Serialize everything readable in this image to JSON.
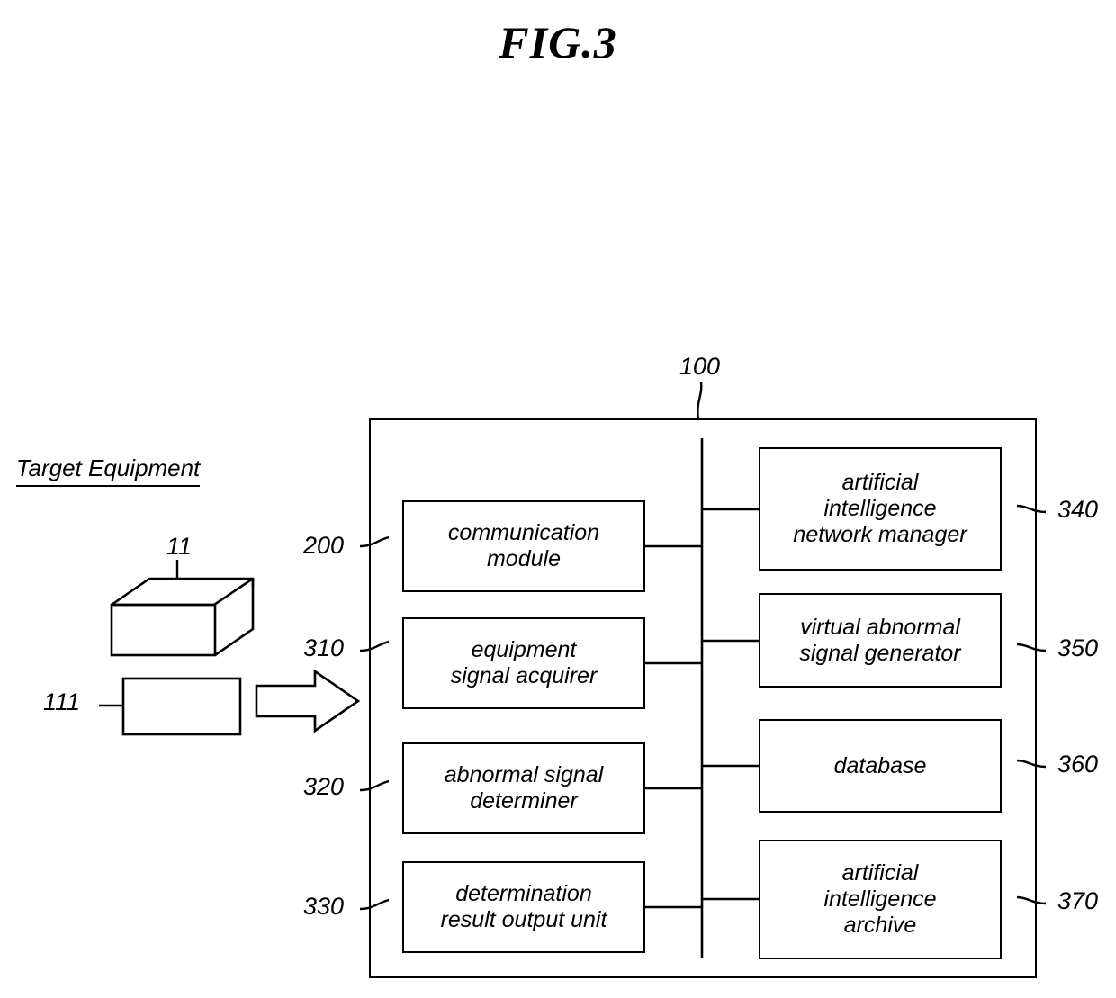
{
  "figure": {
    "title": "FIG.3"
  },
  "left_section": {
    "heading": "Target Equipment",
    "equipment_ref": "11",
    "port_ref": "111"
  },
  "system": {
    "ref": "100",
    "left_column": [
      {
        "ref": "200",
        "label": "communication\nmodule"
      },
      {
        "ref": "310",
        "label": "equipment\nsignal acquirer"
      },
      {
        "ref": "320",
        "label": "abnormal signal\ndeterminer"
      },
      {
        "ref": "330",
        "label": "determination\nresult output unit"
      }
    ],
    "right_column": [
      {
        "ref": "340",
        "label": "artificial\nintelligence\nnetwork manager"
      },
      {
        "ref": "350",
        "label": "virtual abnormal\nsignal generator"
      },
      {
        "ref": "360",
        "label": "database"
      },
      {
        "ref": "370",
        "label": "artificial\nintelligence\narchive"
      }
    ]
  }
}
